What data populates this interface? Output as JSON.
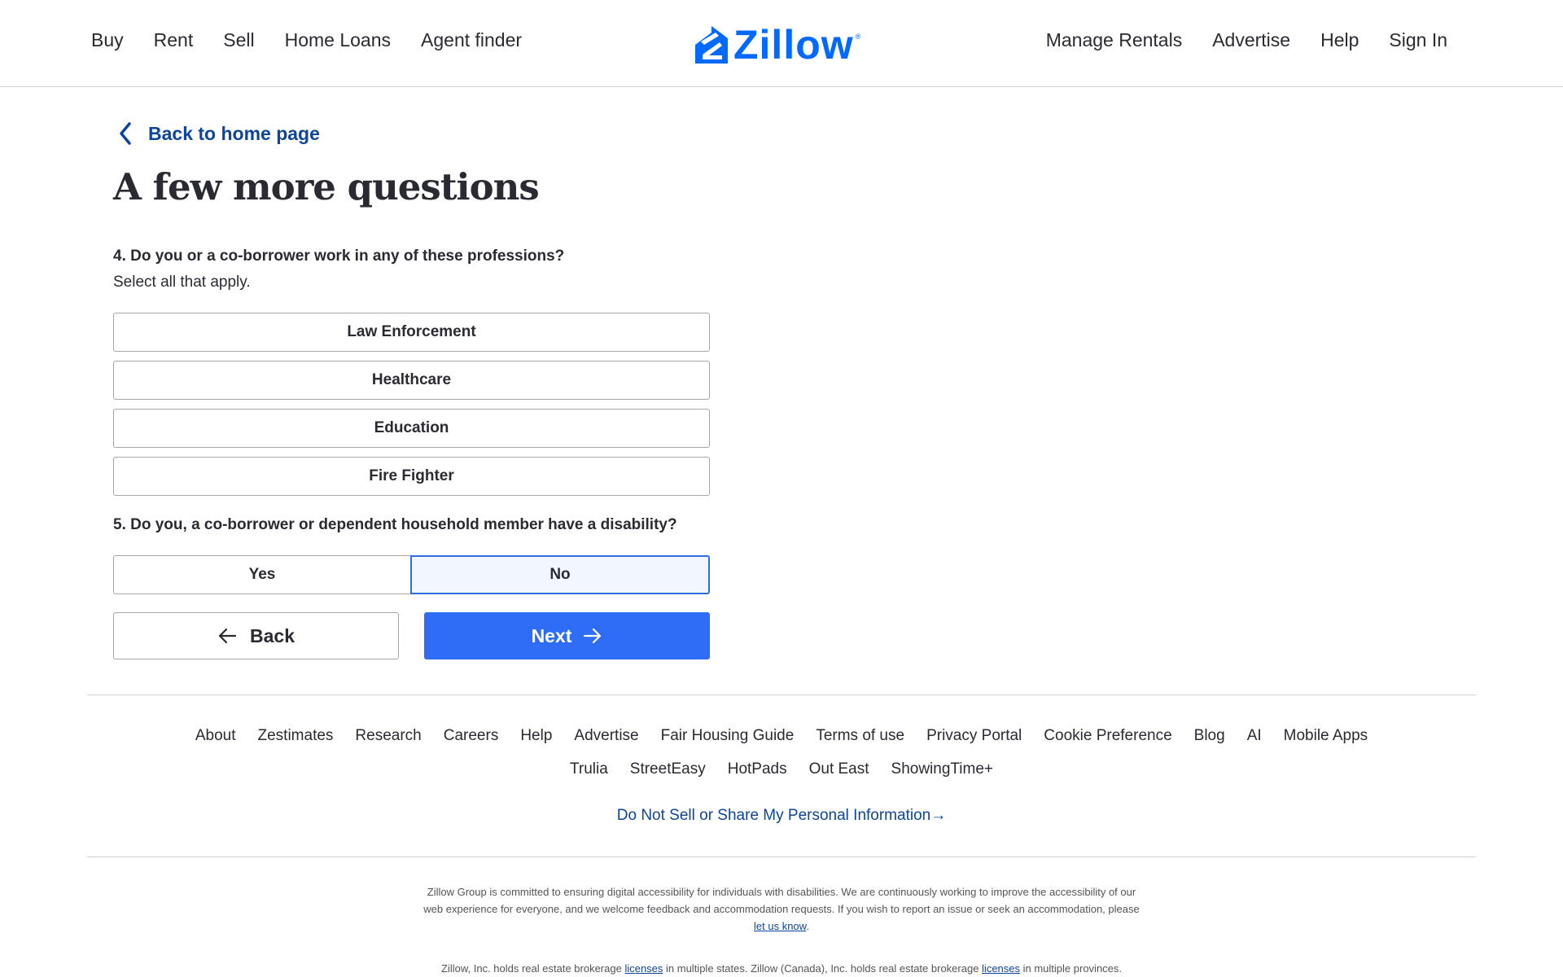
{
  "header": {
    "nav_left": [
      "Buy",
      "Rent",
      "Sell",
      "Home Loans",
      "Agent finder"
    ],
    "nav_right": [
      "Manage Rentals",
      "Advertise",
      "Help",
      "Sign In"
    ],
    "logo_text": "Zillow",
    "logo_mark": "zillow-house-icon",
    "brand_color": "#006aff"
  },
  "main": {
    "back_link": "Back to home page",
    "title": "A few more questions",
    "q4": {
      "text": "4. Do you or a co-borrower work in any of these professions?",
      "subtext": "Select all that apply.",
      "options": [
        "Law Enforcement",
        "Healthcare",
        "Education",
        "Fire Fighter"
      ]
    },
    "q5": {
      "text": "5. Do you, a co-borrower or dependent household member have a disability?",
      "yes": "Yes",
      "no": "No",
      "selected": "No"
    },
    "back_button": "Back",
    "next_button": "Next",
    "accent_color": "#2e6cf6"
  },
  "footer": {
    "links_row1": [
      "About",
      "Zestimates",
      "Research",
      "Careers",
      "Help",
      "Advertise",
      "Fair Housing Guide",
      "Terms of use",
      "Privacy Portal",
      "Cookie Preference",
      "Blog",
      "AI",
      "Mobile Apps"
    ],
    "links_row2": [
      "Trulia",
      "StreetEasy",
      "HotPads",
      "Out East",
      "ShowingTime+"
    ],
    "do_not_sell": "Do Not Sell or Share My Personal Information→",
    "disclaimer_line1": "Zillow Group is committed to ensuring digital accessibility for individuals with disabilities. We are continuously working to improve the accessibility of our",
    "disclaimer_line2": "web experience for everyone, and we welcome feedback and accommodation requests. If you wish to report an issue or seek an accommodation, please",
    "disclaimer_link": "let us know",
    "disclaimer_end": ".",
    "licenses_text1": "Zillow, Inc. holds real estate brokerage ",
    "licenses_link": "licenses",
    "licenses_text2": " in multiple states. Zillow (Canada), Inc. holds real estate brokerage ",
    "licenses_text3": " in multiple provinces."
  }
}
